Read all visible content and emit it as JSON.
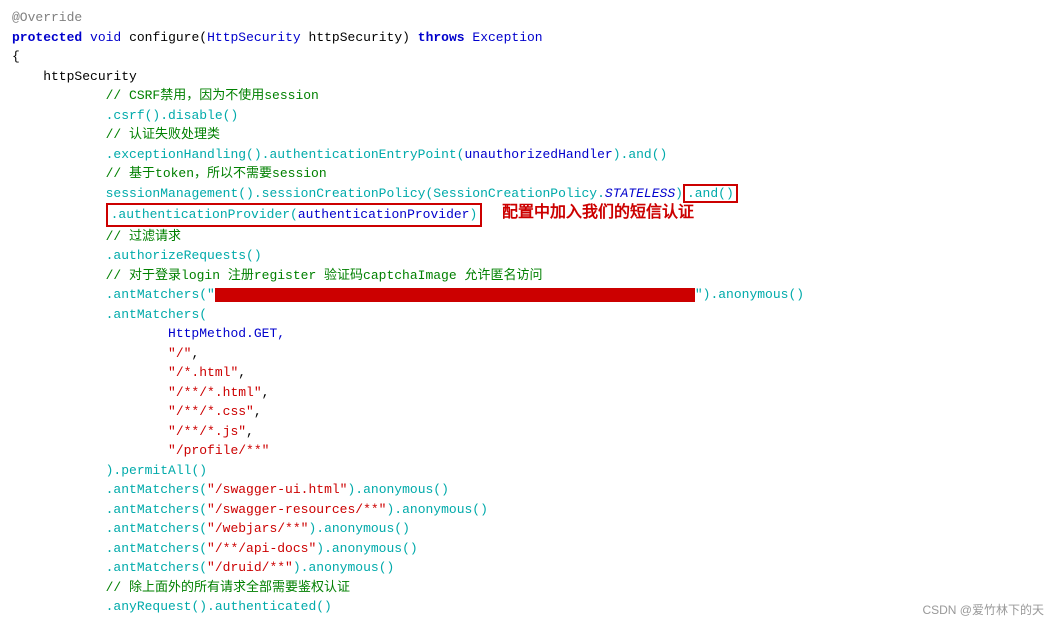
{
  "code": {
    "lines": [
      {
        "id": "l1",
        "type": "annotation_line",
        "content": "@Override"
      },
      {
        "id": "l2",
        "type": "signature",
        "content": "protected void configure(HttpSecurity httpSecurity) throws Exception"
      },
      {
        "id": "l3",
        "type": "brace",
        "content": "{"
      },
      {
        "id": "l4",
        "type": "indent1",
        "content": "    httpSecurity"
      },
      {
        "id": "l5",
        "type": "comment",
        "content": "            // CSRF禁用，因为不使用session"
      },
      {
        "id": "l6",
        "type": "code",
        "content": "            .csrf().disable()"
      },
      {
        "id": "l7",
        "type": "comment",
        "content": "            // 认证失败处理类"
      },
      {
        "id": "l8",
        "type": "code",
        "content": "            .exceptionHandling().authenticationEntryPoint(unauthorizedHandler).and()"
      },
      {
        "id": "l9",
        "type": "comment",
        "content": "            // 基于token，所以不需要session"
      },
      {
        "id": "l10",
        "type": "code_highlight",
        "content": "            sessionManagement().sessionCreationPolicy(SessionCreationPolicy.STATELESS).and()"
      },
      {
        "id": "l11",
        "type": "code_box",
        "content": "            .authenticationProvider(authenticationProvider)"
      },
      {
        "id": "l12",
        "type": "comment",
        "content": "            // 过滤请求"
      },
      {
        "id": "l13",
        "type": "code",
        "content": "            .authorizeRequests()"
      },
      {
        "id": "l14",
        "type": "comment",
        "content": "            // 对于登录login 注册register 验证码captchaImage 允许匿名访问"
      },
      {
        "id": "l15",
        "type": "redacted",
        "prefix": "            .antMatchers(\"",
        "suffix": "\").anonymous()"
      },
      {
        "id": "l16",
        "type": "code",
        "content": "            .antMatchers("
      },
      {
        "id": "l17",
        "type": "code",
        "content": "                    HttpMethod.GET,"
      },
      {
        "id": "l18",
        "type": "string_line",
        "content": "                    \"/\","
      },
      {
        "id": "l19",
        "type": "string_line",
        "content": "                    \"/*.html\","
      },
      {
        "id": "l20",
        "type": "string_line",
        "content": "                    \"/**/*.html\","
      },
      {
        "id": "l21",
        "type": "string_line",
        "content": "                    \"/**/*.css\","
      },
      {
        "id": "l22",
        "type": "string_line",
        "content": "                    \"/**/*.js\","
      },
      {
        "id": "l23",
        "type": "string_line",
        "content": "                    \"/profile/**\""
      },
      {
        "id": "l24",
        "type": "code",
        "content": "            ).permitAll()"
      },
      {
        "id": "l25",
        "type": "code",
        "content": "            .antMatchers(\"/swagger-ui.html\").anonymous()"
      },
      {
        "id": "l26",
        "type": "code",
        "content": "            .antMatchers(\"/swagger-resources/**\").anonymous()"
      },
      {
        "id": "l27",
        "type": "code",
        "content": "            .antMatchers(\"/webjars/**\").anonymous()"
      },
      {
        "id": "l28",
        "type": "code",
        "content": "            .antMatchers(\"/**/api-docs\").anonymous()"
      },
      {
        "id": "l29",
        "type": "code",
        "content": "            .antMatchers(\"/druid/**\").anonymous()"
      },
      {
        "id": "l30",
        "type": "comment",
        "content": "            // 除上面外的所有请求全部需要鉴权认证"
      },
      {
        "id": "l31",
        "type": "code",
        "content": "            .anyRequest().authenticated()"
      }
    ],
    "annotation_text": "配置中加入我们的短信认证",
    "watermark": "CSDN @爱竹林下的天"
  }
}
